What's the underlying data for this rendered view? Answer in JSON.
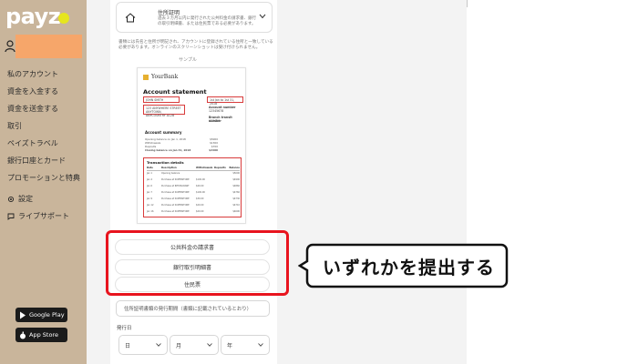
{
  "sidebar": {
    "logo": "payz",
    "nav": [
      "私のアカウント",
      "資金を入金する",
      "資金を送金する",
      "取引",
      "ペイズトラベル",
      "銀行口座とカード",
      "プロモーションと特典"
    ],
    "sub": [
      "設定",
      "ライブサポート"
    ],
    "google_play": "Google Play",
    "app_store": "App Store"
  },
  "doc_card": {
    "title": "住所証明",
    "desc": "過去３カ月以内に発行された公共料金の請求書、銀行の取引明細書、または住民票である必要があります。"
  },
  "info_text": "書類には氏名と住所が明記され、アカウントに登録されている住所と一致している必要があります。オンラインのスクリーンショットは受け付けられません。",
  "sample_label": "サンプル",
  "statement": {
    "bank": "YourBank",
    "title": "Account statement",
    "name": "JOHN SMITH",
    "address": "123 ANYWHERE STREET\nANYTOWN, ANYCOUNTRY A12B",
    "date": "1st Jan to 1st 31, 2018",
    "account_number_label": "Account number",
    "account_number": "12345678",
    "branch_label": "Branch transit number",
    "branch": "123456",
    "summary_title": "Account summary",
    "summary_rows": [
      [
        "Opening balance on Jan 1, 2018",
        "$5000"
      ],
      [
        "Withdrawals",
        "$1300"
      ],
      [
        "Deposits",
        "$700"
      ],
      [
        "Closing balance on Jan 31, 2018",
        "$4400"
      ]
    ],
    "tx_title": "Transaction details",
    "tx_headers": [
      "Date",
      "Description",
      "Withdrawals",
      "Deposits",
      "Balance"
    ],
    "tx_rows": [
      [
        "Jan 1",
        "Opening balance",
        "",
        "",
        "$5000"
      ],
      [
        "Jan 4",
        "Purchase at SUPERSTORE",
        "$100.00",
        "",
        "$4900"
      ],
      [
        "Jan 6",
        "Purchase at RESTAURANT",
        "$40.00",
        "",
        "$4860"
      ],
      [
        "Jan 7",
        "Purchase at SUPERSTORE",
        "$100.00",
        "",
        "$4760"
      ],
      [
        "Jan 9",
        "Purchase at SUPERSTORE",
        "$30.00",
        "",
        "$4730"
      ],
      [
        "Jan 12",
        "Purchase at SUPERSTORE",
        "$20.00",
        "",
        "$4710"
      ],
      [
        "Jan 16",
        "Purchase at SUPERSTORE",
        "$20.00",
        "",
        "$4690"
      ]
    ]
  },
  "options": [
    "公共料金の請求書",
    "銀行取引明細書",
    "住民票"
  ],
  "callout": "いずれかを提出する",
  "date_field_placeholder": "住所証明書類の発行期間（書類に記載されているとおり）",
  "issue_label": "発行日",
  "selects": [
    "日",
    "月",
    "年"
  ]
}
